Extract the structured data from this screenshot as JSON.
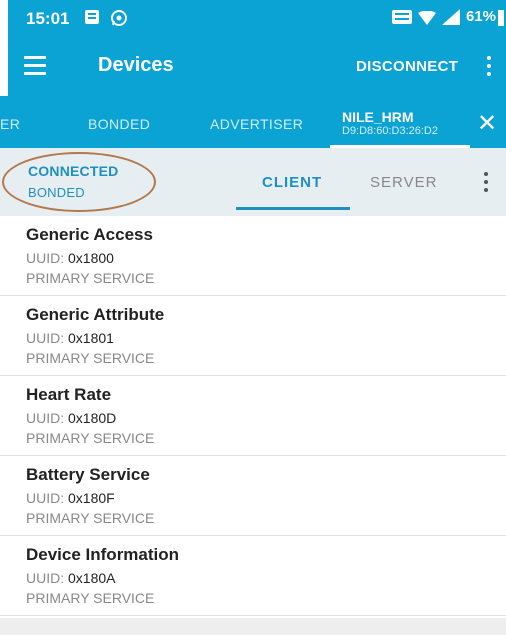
{
  "status_bar": {
    "time": "15:01",
    "battery": "61%",
    "icons": [
      "gallery-icon",
      "whatsapp-icon",
      "lte-icon",
      "wifi-icon",
      "signal-icon",
      "battery-icon"
    ]
  },
  "toolbar": {
    "title": "Devices",
    "disconnect_label": "DISCONNECT",
    "color": "#0aa3d4"
  },
  "device_tabs": {
    "partial_label": "ER",
    "bonded_label": "BONDED",
    "advertiser_label": "ADVERTISER",
    "active_device_name": "NILE_HRM",
    "active_device_mac": "D9:D8:60:D3:26:D2"
  },
  "connection": {
    "state": "CONNECTED",
    "bond_state": "BONDED"
  },
  "subtabs": {
    "client_label": "CLIENT",
    "server_label": "SERVER",
    "active": "CLIENT",
    "accent": "#1f8fc0"
  },
  "uuid_prefix": "UUID:",
  "services": [
    {
      "name": "Generic Access",
      "uuid": "0x1800",
      "type": "PRIMARY SERVICE"
    },
    {
      "name": "Generic Attribute",
      "uuid": "0x1801",
      "type": "PRIMARY SERVICE"
    },
    {
      "name": "Heart Rate",
      "uuid": "0x180D",
      "type": "PRIMARY SERVICE"
    },
    {
      "name": "Battery Service",
      "uuid": "0x180F",
      "type": "PRIMARY SERVICE"
    },
    {
      "name": "Device Information",
      "uuid": "0x180A",
      "type": "PRIMARY SERVICE"
    }
  ]
}
